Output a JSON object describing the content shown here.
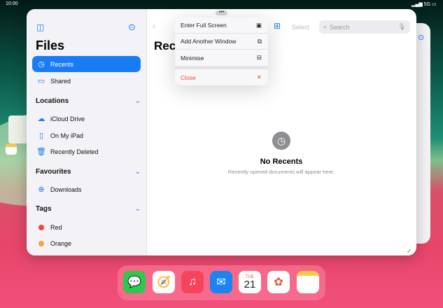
{
  "status": {
    "time": "10:00",
    "network": "5G"
  },
  "sidebar": {
    "title": "Files",
    "items": [
      {
        "label": "Recents",
        "icon": "clock-icon"
      },
      {
        "label": "Shared",
        "icon": "shared-folder-icon"
      }
    ],
    "locations": {
      "header": "Locations",
      "items": [
        {
          "label": "iCloud Drive",
          "icon": "cloud-icon"
        },
        {
          "label": "On My iPad",
          "icon": "ipad-icon"
        },
        {
          "label": "Recently Deleted",
          "icon": "trash-icon"
        }
      ]
    },
    "favourites": {
      "header": "Favourites",
      "items": [
        {
          "label": "Downloads",
          "icon": "download-icon"
        }
      ]
    },
    "tags": {
      "header": "Tags",
      "items": [
        {
          "label": "Red",
          "color": "#f2453d"
        },
        {
          "label": "Orange",
          "color": "#f8a33a"
        }
      ]
    }
  },
  "toolbar": {
    "select": "Select",
    "search_placeholder": "Search"
  },
  "main": {
    "title": "Rec",
    "empty_title": "No Recents",
    "empty_subtitle": "Recently opened documents will appear here."
  },
  "menu": {
    "items": [
      "Enter Full Screen",
      "Add Another Window",
      "Minimise"
    ],
    "close": "Close"
  },
  "dock": {
    "apps": [
      "Messages",
      "Safari",
      "Music",
      "Mail",
      "Calendar",
      "Photos",
      "Notes"
    ],
    "calendar_day": "TUE",
    "calendar_date": "21"
  },
  "colors": {
    "accent": "#1a7cf5",
    "destructive": "#f2453d"
  }
}
